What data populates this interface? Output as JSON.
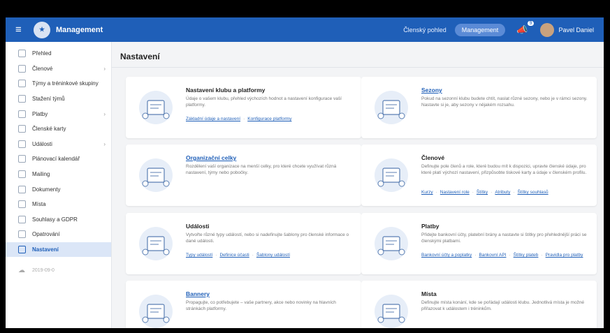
{
  "topbar": {
    "menu_icon": "hamburger-icon",
    "app_title": "Management",
    "link_clen": "Členský pohled",
    "pill_management": "Management",
    "notification_count": "9",
    "user_name": "Pavel Daniel"
  },
  "sidebar": {
    "items": [
      {
        "label": "Přehled",
        "icon": "home-icon",
        "chevron": false
      },
      {
        "label": "Členové",
        "icon": "users-icon",
        "chevron": true
      },
      {
        "label": "Týmy a tréninkové skupiny",
        "icon": "team-icon",
        "chevron": false
      },
      {
        "label": "Stažení týmů",
        "icon": "download-icon",
        "chevron": false
      },
      {
        "label": "Platby",
        "icon": "payments-icon",
        "chevron": true
      },
      {
        "label": "Členské karty",
        "icon": "card-icon",
        "chevron": false
      },
      {
        "label": "Události",
        "icon": "calendar-icon",
        "chevron": true
      },
      {
        "label": "Plánovací kalendář",
        "icon": "planner-icon",
        "chevron": false
      },
      {
        "label": "Mailing",
        "icon": "mail-icon",
        "chevron": false
      },
      {
        "label": "Dokumenty",
        "icon": "document-icon",
        "chevron": false
      },
      {
        "label": "Místa",
        "icon": "location-icon",
        "chevron": false
      },
      {
        "label": "Souhlasy a GDPR",
        "icon": "consent-icon",
        "chevron": false
      },
      {
        "label": "Opatrování",
        "icon": "care-icon",
        "chevron": false
      },
      {
        "label": "Nastavení",
        "icon": "settings-icon",
        "chevron": false,
        "active": true
      }
    ],
    "footer_label": "2019-09-0"
  },
  "main": {
    "page_title": "Nastavení",
    "cards": [
      {
        "title": "Nastavení klubu a platformy",
        "title_is_link": false,
        "description": "Údaje o vašem klubu, přehled výchozích hodnot a nastavení konfigurace vaší platformy.",
        "links": [
          "Základní údaje a nastavení",
          "Konfigurace platformy"
        ]
      },
      {
        "title": "Sezony",
        "title_is_link": true,
        "description": "Pokud na sezonní klubu budete chtít, naslat různé sezony, nebo je v rámci sezony. Nastavte si je, aby sezony v nějakém rozsahu.",
        "links": []
      },
      {
        "title": "Organizační celky",
        "title_is_link": true,
        "description": "Rozdělení vaší organizace na menší celky, pro které chcete využívat různá nastavení, týmy nebo pobočky.",
        "links": []
      },
      {
        "title": "Členové",
        "title_is_link": false,
        "description": "Definujte pole členů a role, které budou mít k dispozici, upravte členské údaje, pro které platí výchozí nastavení, přizpůsobte tiskové karty a údaje v členském profilu.",
        "links": [
          "Kurzy",
          "Nastavení role",
          "Štítky",
          "Atributy",
          "Štítky souhlasů"
        ]
      },
      {
        "title": "Události",
        "title_is_link": false,
        "description": "Vytvořte různé typy událostí, nebo si nadefinujte šablony pro členské informace o dané události.",
        "links": [
          "Typy událostí",
          "Definice účasti",
          "Šablony událostí"
        ]
      },
      {
        "title": "Platby",
        "title_is_link": false,
        "description": "Přidejte bankovní účty, platební brány a nastavte si štítky pro přehlednější práci se členskými platbami.",
        "links": [
          "Bankovní účty a poplatky",
          "Bankovní API",
          "Štítky plateb",
          "Pravidla pro platby"
        ]
      },
      {
        "title": "Bannery",
        "title_is_link": true,
        "description": "Propagujte, co potřebujete – vaše partnery, akce nebo novinky na hlavních stránkách platformy.",
        "links": []
      },
      {
        "title": "Místa",
        "title_is_link": false,
        "description": "Definujte místa konání, kde se pořádají události klubu. Jednotlivá místa je možné přiřazovat k událostem i tréninkům.",
        "links": []
      }
    ]
  },
  "colors": {
    "topbar": "#1f5fb8",
    "accent": "#1f5fb8",
    "active_bg": "#dbe6f7",
    "page_bg": "#f3f4f6"
  }
}
